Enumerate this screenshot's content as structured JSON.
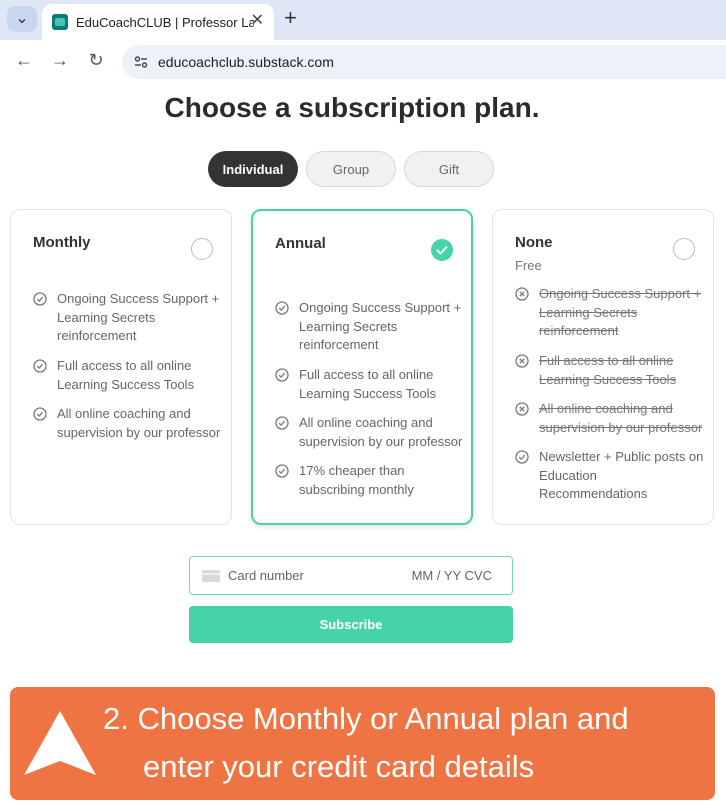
{
  "browser": {
    "tab_title": "EduCoachCLUB | Professor Lan",
    "url": "educoachclub.substack.com",
    "close_glyph": "✕",
    "new_tab_glyph": "+",
    "back_glyph": "←",
    "forward_glyph": "→",
    "reload_glyph": "↻",
    "menu_glyph": "⌄"
  },
  "page": {
    "title": "Choose a subscription plan."
  },
  "segments": [
    {
      "label": "Individual",
      "active": true
    },
    {
      "label": "Group",
      "active": false
    },
    {
      "label": "Gift",
      "active": false
    }
  ],
  "plans": [
    {
      "name": "Monthly",
      "subtitle": "",
      "selected": false,
      "features": [
        {
          "text": "Ongoing Success Support + Learning Secrets reinforcement",
          "included": true
        },
        {
          "text": "Full access to all online Learning Success Tools",
          "included": true
        },
        {
          "text": "All online coaching and supervision by our professor",
          "included": true
        }
      ]
    },
    {
      "name": "Annual",
      "subtitle": "",
      "selected": true,
      "features": [
        {
          "text": "Ongoing Success Support + Learning Secrets reinforcement",
          "included": true
        },
        {
          "text": "Full access to all online Learning Success Tools",
          "included": true
        },
        {
          "text": "All online coaching and supervision by our professor",
          "included": true
        },
        {
          "text": "17% cheaper than subscribing monthly",
          "included": true
        }
      ]
    },
    {
      "name": "None",
      "subtitle": "Free",
      "selected": false,
      "features": [
        {
          "text": "Ongoing Success Support + Learning Secrets reinforcement",
          "included": false
        },
        {
          "text": "Full access to all online Learning Success Tools",
          "included": false
        },
        {
          "text": "All online coaching and supervision by our professor",
          "included": false
        },
        {
          "text": "Newsletter + Public posts on Education Recommendations",
          "included": true
        }
      ]
    }
  ],
  "payment": {
    "card_placeholder": "Card number",
    "expiry_cvc_placeholder": "MM / YY  CVC",
    "subscribe_label": "Subscribe"
  },
  "banner": {
    "line1": "2. Choose Monthly or Annual plan and",
    "line2": "enter your credit card details"
  },
  "colors": {
    "accent": "#45d3a7",
    "banner": "#ef7444",
    "active_segment": "#333333"
  }
}
